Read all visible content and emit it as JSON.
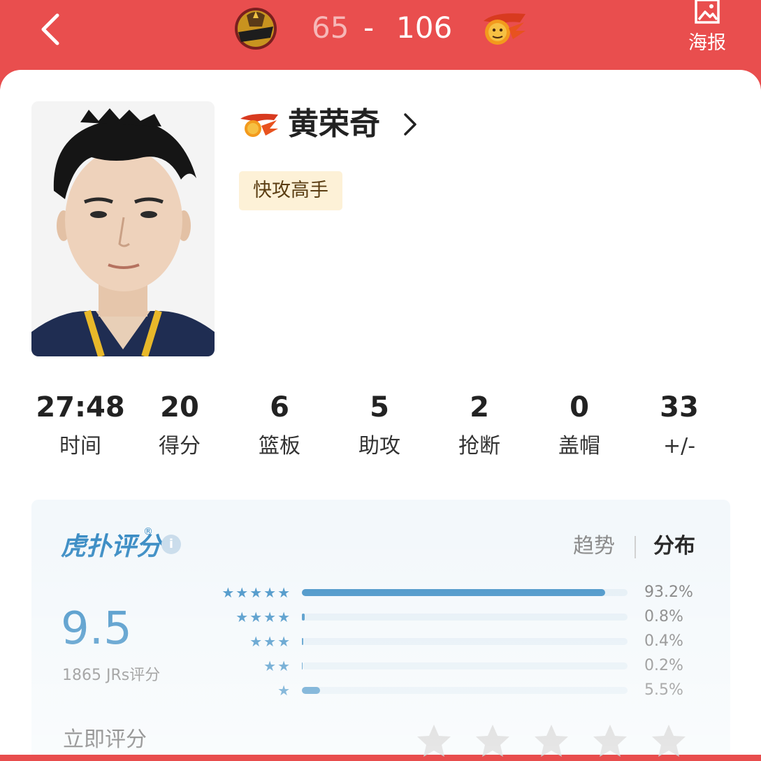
{
  "header": {
    "home_score": "65",
    "dash": "-",
    "away_score": "106",
    "poster_label": "海报",
    "colors": {
      "bar": "#e94e4e"
    }
  },
  "player": {
    "name": "黄荣奇",
    "tag": "快攻高手"
  },
  "stats": [
    {
      "value": "27:48",
      "label": "时间"
    },
    {
      "value": "20",
      "label": "得分"
    },
    {
      "value": "6",
      "label": "篮板"
    },
    {
      "value": "5",
      "label": "助攻"
    },
    {
      "value": "2",
      "label": "抢断"
    },
    {
      "value": "0",
      "label": "盖帽"
    },
    {
      "value": "33",
      "label": "+/-"
    }
  ],
  "rating": {
    "brand": "虎扑评分",
    "reg": "®",
    "info": "i",
    "tabs": {
      "trend": "趋势",
      "distribution": "分布"
    },
    "score": "9.5",
    "voters": "1865 JRs评分",
    "rate_now": "立即评分",
    "distribution": [
      {
        "stars": "★★★★★",
        "percent": 93.2,
        "percent_label": "93.2%"
      },
      {
        "stars": "★★★★",
        "percent": 0.8,
        "percent_label": "0.8%"
      },
      {
        "stars": "★★★",
        "percent": 0.4,
        "percent_label": "0.4%"
      },
      {
        "stars": "★★",
        "percent": 0.2,
        "percent_label": "0.2%"
      },
      {
        "stars": "★",
        "percent": 5.5,
        "percent_label": "5.5%"
      }
    ],
    "colors": {
      "accent": "#3a8cc4",
      "tag_bg": "#fdf1d7"
    }
  }
}
